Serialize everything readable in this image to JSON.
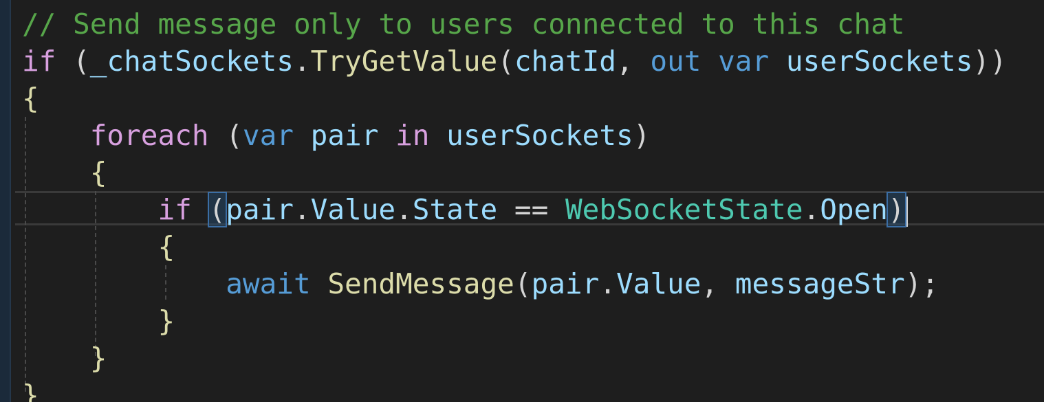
{
  "editor": {
    "language": "C#",
    "theme": "dark",
    "colors": {
      "background": "#1e1e1e",
      "comment": "#57a64a",
      "keyword": "#569cd6",
      "control": "#d8a0df",
      "type": "#4ec9b0",
      "method": "#dcdcaa",
      "identifier": "#9cdcfe",
      "plain": "#d4d4d4"
    },
    "lines": [
      {
        "tokens": [
          {
            "text": "// Send message only to users connected to this chat",
            "kind": "comment"
          }
        ]
      },
      {
        "tokens": [
          {
            "text": "if",
            "kind": "control"
          },
          {
            "text": " (",
            "kind": "plain"
          },
          {
            "text": "_chatSockets",
            "kind": "ident"
          },
          {
            "text": ".",
            "kind": "plain"
          },
          {
            "text": "TryGetValue",
            "kind": "method"
          },
          {
            "text": "(",
            "kind": "plain"
          },
          {
            "text": "chatId",
            "kind": "ident"
          },
          {
            "text": ", ",
            "kind": "plain"
          },
          {
            "text": "out",
            "kind": "keyword"
          },
          {
            "text": " ",
            "kind": "plain"
          },
          {
            "text": "var",
            "kind": "keyword"
          },
          {
            "text": " ",
            "kind": "plain"
          },
          {
            "text": "userSockets",
            "kind": "ident"
          },
          {
            "text": "))",
            "kind": "plain"
          }
        ]
      },
      {
        "tokens": [
          {
            "text": "{",
            "kind": "brace"
          }
        ]
      },
      {
        "tokens": [
          {
            "text": "    ",
            "kind": "plain"
          },
          {
            "text": "foreach",
            "kind": "control"
          },
          {
            "text": " (",
            "kind": "plain"
          },
          {
            "text": "var",
            "kind": "keyword"
          },
          {
            "text": " ",
            "kind": "plain"
          },
          {
            "text": "pair",
            "kind": "ident"
          },
          {
            "text": " ",
            "kind": "plain"
          },
          {
            "text": "in",
            "kind": "control"
          },
          {
            "text": " ",
            "kind": "plain"
          },
          {
            "text": "userSockets",
            "kind": "ident"
          },
          {
            "text": ")",
            "kind": "plain"
          }
        ]
      },
      {
        "tokens": [
          {
            "text": "    ",
            "kind": "plain"
          },
          {
            "text": "{",
            "kind": "brace"
          }
        ]
      },
      {
        "tokens": [
          {
            "text": "        ",
            "kind": "plain"
          },
          {
            "text": "if",
            "kind": "control"
          },
          {
            "text": " ",
            "kind": "plain"
          },
          {
            "text": "(",
            "kind": "plain",
            "match": true
          },
          {
            "text": "pair",
            "kind": "ident"
          },
          {
            "text": ".",
            "kind": "plain"
          },
          {
            "text": "Value",
            "kind": "ident"
          },
          {
            "text": ".",
            "kind": "plain"
          },
          {
            "text": "State",
            "kind": "ident"
          },
          {
            "text": " == ",
            "kind": "plain"
          },
          {
            "text": "WebSocketState",
            "kind": "type"
          },
          {
            "text": ".",
            "kind": "plain"
          },
          {
            "text": "Open",
            "kind": "ident"
          },
          {
            "text": ")",
            "kind": "plain",
            "match": true
          },
          {
            "text": "",
            "kind": "caret"
          }
        ]
      },
      {
        "tokens": [
          {
            "text": "        ",
            "kind": "plain"
          },
          {
            "text": "{",
            "kind": "brace"
          }
        ]
      },
      {
        "tokens": [
          {
            "text": "            ",
            "kind": "plain"
          },
          {
            "text": "await",
            "kind": "keyword"
          },
          {
            "text": " ",
            "kind": "plain"
          },
          {
            "text": "SendMessage",
            "kind": "method"
          },
          {
            "text": "(",
            "kind": "plain"
          },
          {
            "text": "pair",
            "kind": "ident"
          },
          {
            "text": ".",
            "kind": "plain"
          },
          {
            "text": "Value",
            "kind": "ident"
          },
          {
            "text": ", ",
            "kind": "plain"
          },
          {
            "text": "messageStr",
            "kind": "ident"
          },
          {
            "text": ");",
            "kind": "plain"
          }
        ]
      },
      {
        "tokens": [
          {
            "text": "        ",
            "kind": "plain"
          },
          {
            "text": "}",
            "kind": "brace"
          }
        ]
      },
      {
        "tokens": [
          {
            "text": "    ",
            "kind": "plain"
          },
          {
            "text": "}",
            "kind": "brace"
          }
        ]
      },
      {
        "tokens": [
          {
            "text": "}",
            "kind": "brace"
          }
        ]
      }
    ]
  }
}
